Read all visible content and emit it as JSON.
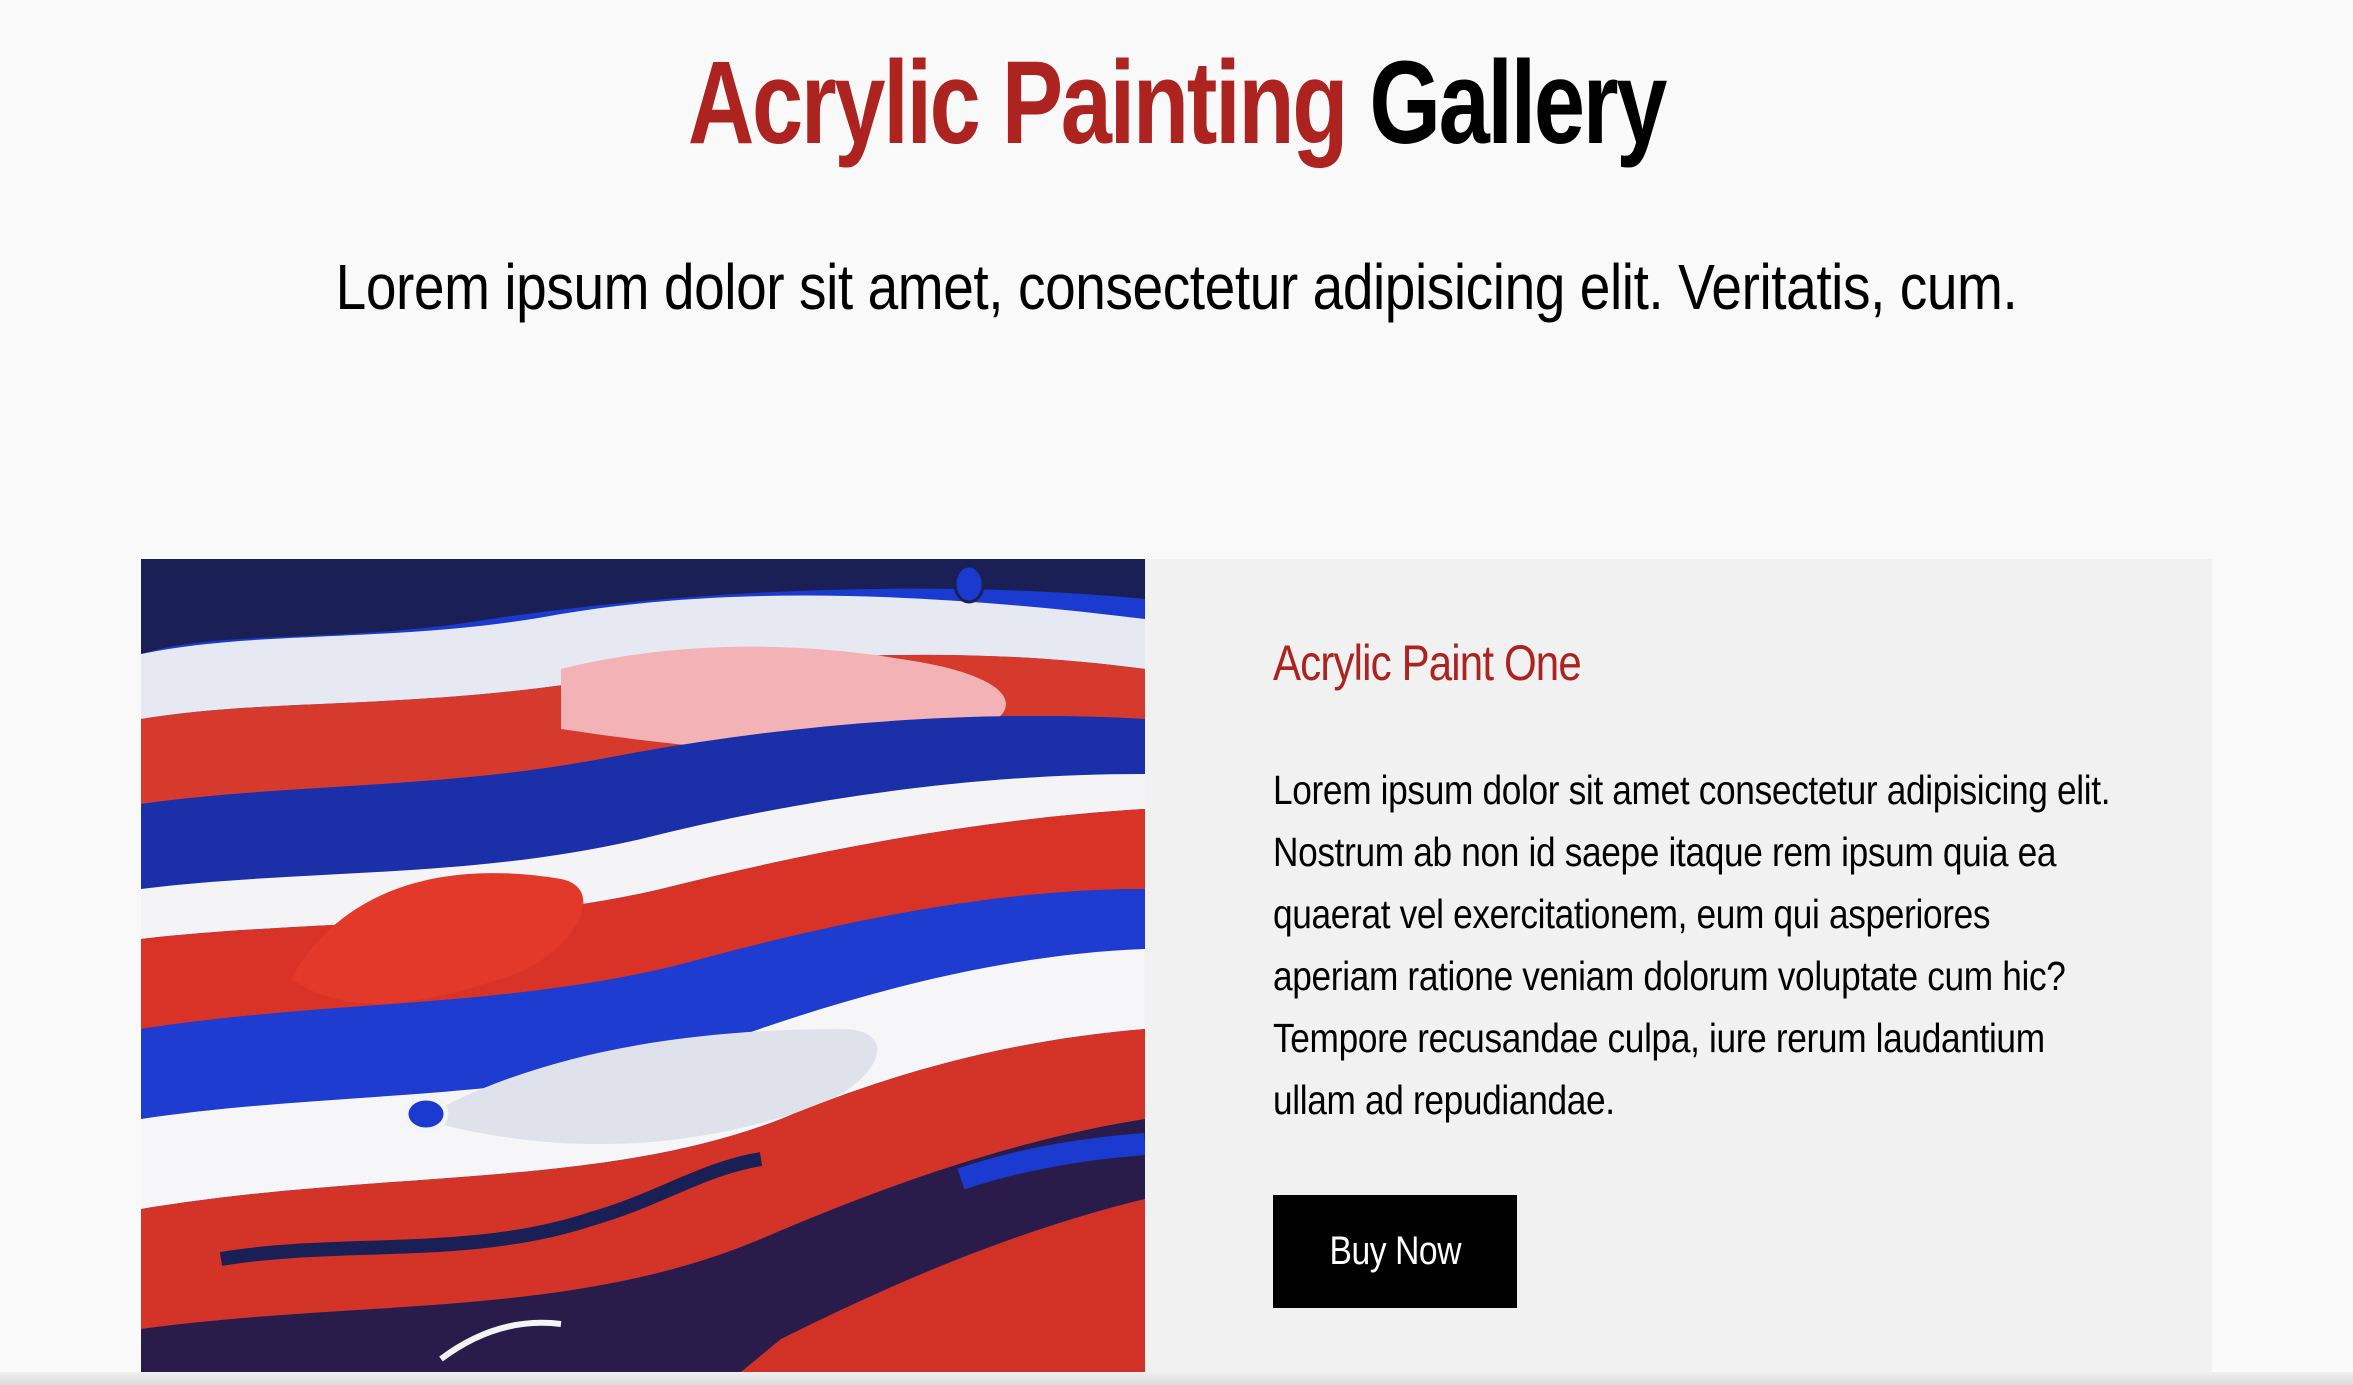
{
  "header": {
    "title_accent": "Acrylic Painting",
    "title_main": "Gallery",
    "subtitle": "Lorem ipsum dolor sit amet, consectetur adipisicing elit. Veritatis, cum."
  },
  "card": {
    "image_name": "acrylic-paint-pour-image",
    "title": "Acrylic Paint One",
    "description": "Lorem ipsum dolor sit amet consectetur adipisicing elit. Nostrum ab non id saepe itaque rem ipsum quia ea quaerat vel exercitationem, eum qui asperiores aperiam ratione veniam dolorum voluptate cum hic? Tempore recusandae culpa, iure rerum laudantium ullam ad repudiandae.",
    "button_label": "Buy Now"
  },
  "colors": {
    "accent": "#ad2320",
    "page_background": "#f9f9f9",
    "card_background": "#f1f1f1",
    "button_background": "#000000",
    "button_text": "#ffffff"
  }
}
